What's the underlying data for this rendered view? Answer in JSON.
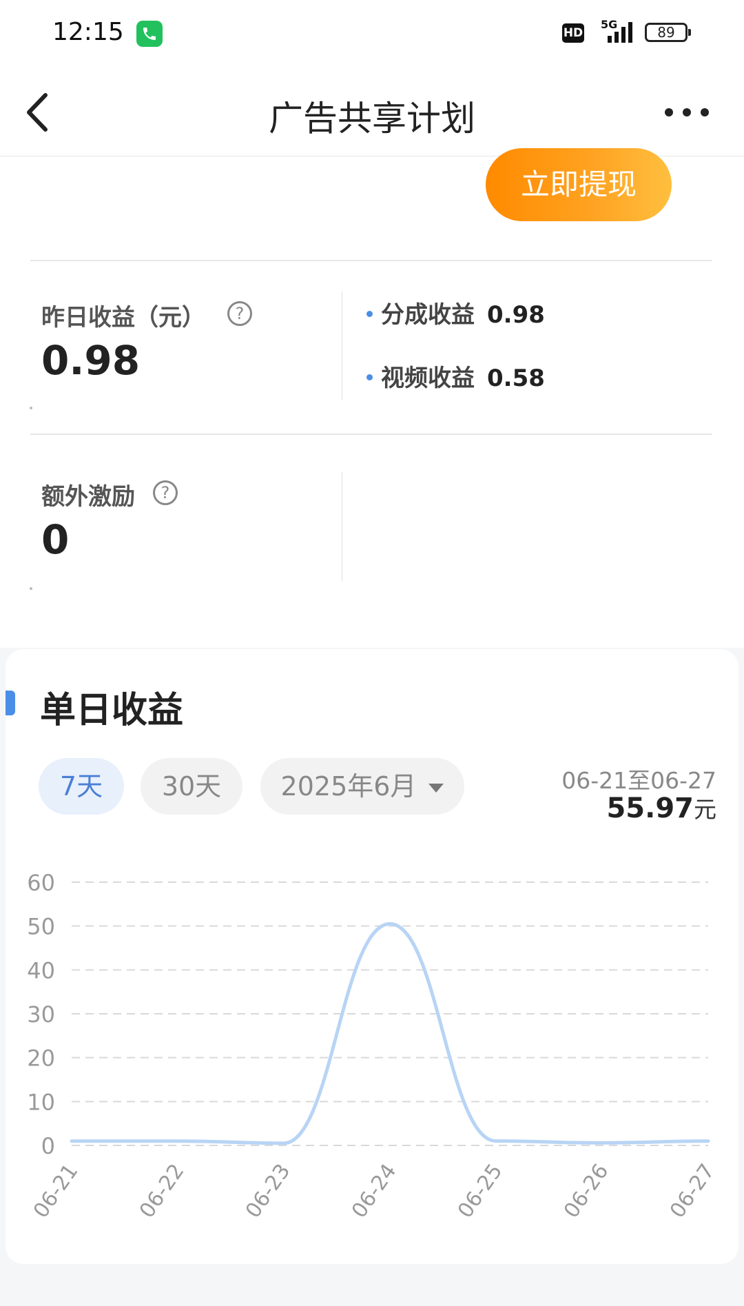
{
  "status_bar": {
    "time": "12:15",
    "hd": "HD",
    "network": "5G",
    "battery": "89"
  },
  "nav": {
    "title": "广告共享计划"
  },
  "withdraw_button": "立即提现",
  "yesterday": {
    "label": "昨日收益（元）",
    "value": "0.98"
  },
  "breakdown": [
    {
      "label": "分成收益",
      "value": "0.98"
    },
    {
      "label": "视频收益",
      "value": "0.58"
    }
  ],
  "extra": {
    "label": "额外激励",
    "value": "0"
  },
  "help_glyph": "?",
  "daily": {
    "title": "单日收益",
    "tabs": [
      "7天",
      "30天",
      "2025年6月"
    ],
    "active_tab": 0,
    "range": "06-21至06-27",
    "total": "55.97",
    "unit": "元"
  },
  "colors": {
    "accent": "#4a8ee8",
    "line": "#b8d4f5",
    "button_from": "#ff8a00",
    "button_to": "#ffbf3f"
  },
  "chart_data": {
    "type": "line",
    "categories": [
      "06-21",
      "06-22",
      "06-23",
      "06-24",
      "06-25",
      "06-26",
      "06-27"
    ],
    "values": [
      0.98,
      0.98,
      0.5,
      50.5,
      1.0,
      0.58,
      0.98
    ],
    "y_ticks": [
      0,
      10,
      20,
      30,
      40,
      50,
      60
    ],
    "ylim": [
      0,
      60
    ],
    "grid": true
  }
}
